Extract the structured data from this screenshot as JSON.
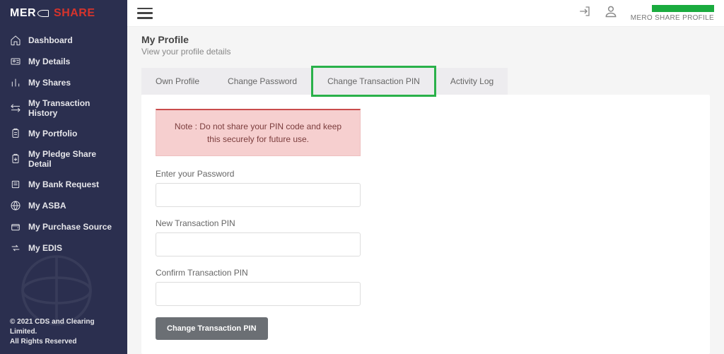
{
  "logo": {
    "part1": "MER",
    "part2": "SHARE"
  },
  "sidebar": {
    "items": [
      {
        "label": "Dashboard"
      },
      {
        "label": "My Details"
      },
      {
        "label": "My Shares"
      },
      {
        "label": "My Transaction History"
      },
      {
        "label": "My Portfolio"
      },
      {
        "label": "My Pledge Share Detail"
      },
      {
        "label": "My Bank Request"
      },
      {
        "label": "My ASBA"
      },
      {
        "label": "My Purchase Source"
      },
      {
        "label": "My EDIS"
      }
    ],
    "footer_line1": "© 2021 CDS and Clearing Limited.",
    "footer_line2": "All Rights Reserved"
  },
  "topbar": {
    "profile_label": "MERO SHARE PROFILE"
  },
  "page": {
    "title": "My Profile",
    "subtitle": "View your profile details"
  },
  "tabs": [
    {
      "label": "Own Profile"
    },
    {
      "label": "Change Password"
    },
    {
      "label": "Change Transaction PIN"
    },
    {
      "label": "Activity Log"
    }
  ],
  "form": {
    "note": "Note : Do not share your PIN code and keep this securely for future use.",
    "password_label": "Enter your Password",
    "new_pin_label": "New Transaction PIN",
    "confirm_pin_label": "Confirm Transaction PIN",
    "submit_label": "Change Transaction PIN"
  }
}
